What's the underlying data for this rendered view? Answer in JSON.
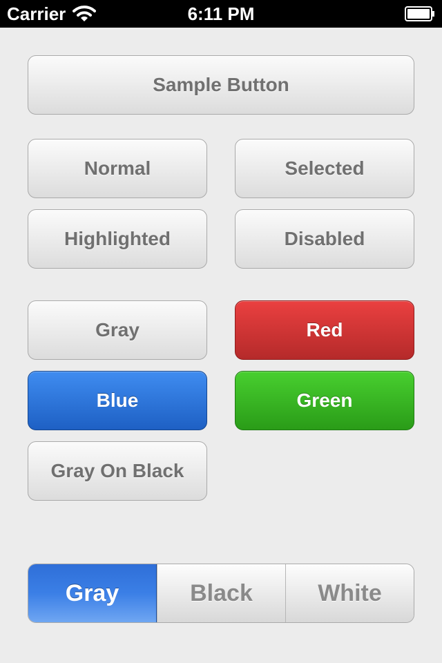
{
  "status_bar": {
    "carrier": "Carrier",
    "time": "6:11 PM"
  },
  "buttons": {
    "sample": "Sample Button",
    "normal": "Normal",
    "selected": "Selected",
    "highlighted": "Highlighted",
    "disabled": "Disabled",
    "gray": "Gray",
    "red": "Red",
    "blue": "Blue",
    "green": "Green",
    "gray_on_black": "Gray On Black"
  },
  "segmented_control": {
    "segments": [
      "Gray",
      "Black",
      "White"
    ],
    "selected": "Gray"
  },
  "colors": {
    "red": "#d93636",
    "blue": "#2b74dc",
    "green": "#38b624",
    "background": "#ececec"
  },
  "icons": {
    "wifi": "wifi-icon",
    "battery": "battery-icon"
  }
}
